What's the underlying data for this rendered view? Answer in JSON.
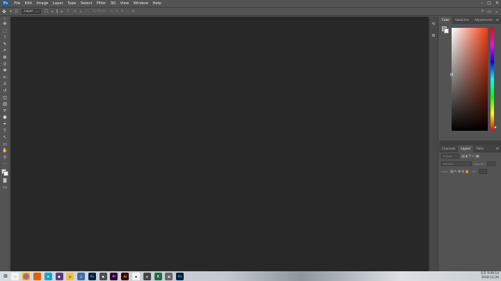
{
  "app": {
    "logo_text": "Ps"
  },
  "menu": [
    "File",
    "Edit",
    "Image",
    "Layer",
    "Type",
    "Select",
    "Filter",
    "3D",
    "View",
    "Window",
    "Help"
  ],
  "window_controls": {
    "minimize": "–",
    "maximize": "□",
    "close": "✕"
  },
  "options_bar": {
    "move_tool_icon": "move-icon",
    "auto_select_label": "Layer",
    "mode_3d_label": "3D Mode:",
    "icons": [
      "align-left-icon",
      "align-center-icon",
      "align-right-icon",
      "align-top-icon",
      "align-middle-icon",
      "align-bottom-icon",
      "more-icon"
    ],
    "right_icons": {
      "search": "⌕",
      "workspace": "▭",
      "chevron": "⌄"
    }
  },
  "tools": [
    "move-icon",
    "marquee-icon",
    "lasso-icon",
    "quick-select-icon",
    "crop-icon",
    "frame-icon",
    "eyedropper-icon",
    "healing-icon",
    "brush-icon",
    "stamp-icon",
    "history-brush-icon",
    "eraser-icon",
    "gradient-icon",
    "blur-icon",
    "dodge-icon",
    "pen-icon",
    "type-icon",
    "path-select-icon",
    "shape-icon",
    "hand-icon",
    "zoom-icon",
    "more-tools-icon"
  ],
  "tool_glyphs": [
    "✥",
    "⬚",
    "⌇",
    "✎",
    "⌗",
    "⊠",
    "⚲",
    "✚",
    "✍",
    "♙",
    "↺",
    "◫",
    "▥",
    "⛛",
    "●",
    "✒",
    "T",
    "↖",
    "▭",
    "✋",
    "⚲",
    "⋯"
  ],
  "colors": {
    "foreground": "#dcdcdc",
    "background": "#ffffff",
    "canvas": "#282828",
    "chrome": "#535353",
    "hue": "#f23a10"
  },
  "color_panel": {
    "tabs": [
      "Color",
      "Swatches",
      "Adjustments"
    ],
    "active_tab": "Color"
  },
  "layers_panel": {
    "tabs": [
      "Channels",
      "Layers",
      "Paths"
    ],
    "active_tab": "Layers",
    "filter_label": "Kind",
    "blend_mode": "Normal",
    "opacity_label": "Opacity:",
    "lock_label": "Lock:",
    "fill_label": "Fill:"
  },
  "taskbar": {
    "items": [
      "chrome",
      "firefox",
      "edge",
      "explorer",
      "ps",
      "ai",
      "pr",
      "xd",
      "ai",
      "ps"
    ],
    "time": "오후 9:09:14",
    "date": "2018-12-20"
  }
}
